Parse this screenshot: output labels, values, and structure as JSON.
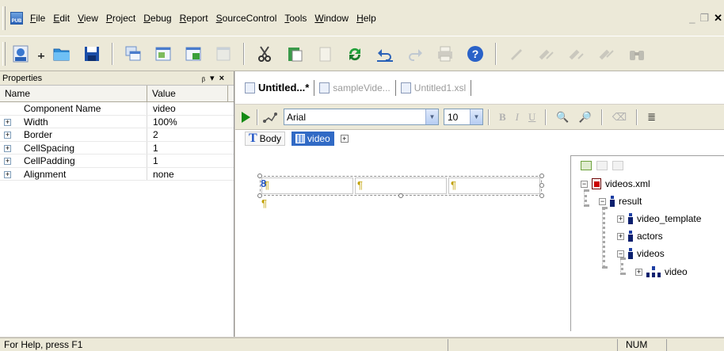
{
  "app": {
    "icon_label": "PUB"
  },
  "menu": [
    "File",
    "Edit",
    "View",
    "Project",
    "Debug",
    "Report",
    "SourceControl",
    "Tools",
    "Window",
    "Help"
  ],
  "window_controls": {
    "minimize": "_",
    "restore": "❐",
    "close": "✕"
  },
  "toolbar": {
    "icons": [
      "pub-open-icon",
      "new-file-icon",
      "open-folder-icon",
      "save-icon",
      "window-cascade-icon",
      "window-tile-icon",
      "window-arrange-icon",
      "window-close-icon",
      "cut-icon",
      "paste-icon",
      "copy-icon",
      "refresh-icon",
      "undo-icon",
      "redo-icon",
      "print-icon",
      "help-icon",
      "edit1-icon",
      "edit2-icon",
      "edit3-icon",
      "edit4-icon",
      "binoculars-icon"
    ]
  },
  "properties": {
    "title": "Properties",
    "pin_glyph": "ᵦ",
    "header": {
      "name": "Name",
      "value": "Value"
    },
    "rows": [
      {
        "name": "Component Name",
        "value": "video",
        "expandable": false
      },
      {
        "name": "Width",
        "value": "100%",
        "expandable": true
      },
      {
        "name": "Border",
        "value": "2",
        "expandable": true
      },
      {
        "name": "CellSpacing",
        "value": "1",
        "expandable": true
      },
      {
        "name": "CellPadding",
        "value": "1",
        "expandable": true
      },
      {
        "name": "Alignment",
        "value": "none",
        "expandable": true
      }
    ]
  },
  "tabs": [
    {
      "label": "Untitled...*",
      "active": true
    },
    {
      "label": "sampleVide...",
      "active": false
    },
    {
      "label": "Untitled1.xsl",
      "active": false
    }
  ],
  "format_bar": {
    "font": "Arial",
    "size": "10",
    "bold": "B",
    "italic": "I",
    "underline": "U"
  },
  "breadcrumbs": {
    "body": "Body",
    "table": "video",
    "expand": "+"
  },
  "design": {
    "pilcrow": "¶"
  },
  "xml_tree": {
    "root": "videos.xml",
    "nodes": [
      "result",
      "video_template",
      "actors",
      "videos",
      "video"
    ]
  },
  "status": {
    "message": "For Help, press F1",
    "num": "NUM"
  }
}
